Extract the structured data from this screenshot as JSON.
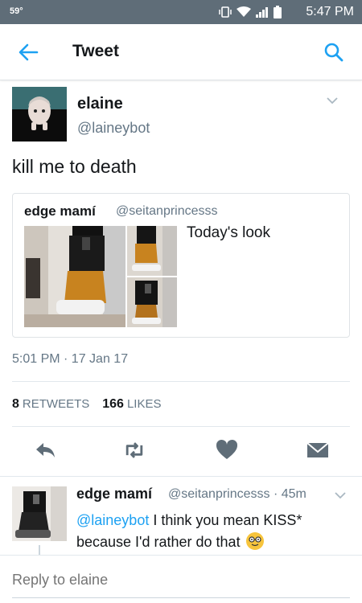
{
  "status_bar": {
    "temperature": "59°",
    "time": "5:47 PM"
  },
  "header": {
    "title": "Tweet"
  },
  "tweet": {
    "author_name": "elaine",
    "author_handle": "@laineybot",
    "text": "kill me to death",
    "timestamp": "5:01 PM · 17 Jan 17",
    "retweets_count": "8",
    "retweets_label": "RETWEETS",
    "likes_count": "166",
    "likes_label": "LIKES"
  },
  "quoted_tweet": {
    "author_name": "edge mamí",
    "author_handle": "@seitanprincesss",
    "text": "Today's look"
  },
  "reply": {
    "author_name": "edge mamí",
    "author_handle": "@seitanprincesss · 45m",
    "mention": "@laineybot",
    "text": " I think you mean KISS* because I'd rather do that "
  },
  "reply_bar": {
    "placeholder": "Reply to elaine"
  },
  "colors": {
    "accent": "#1da1f2",
    "status_bar": "#5f6d78",
    "secondary_text": "#657786"
  }
}
